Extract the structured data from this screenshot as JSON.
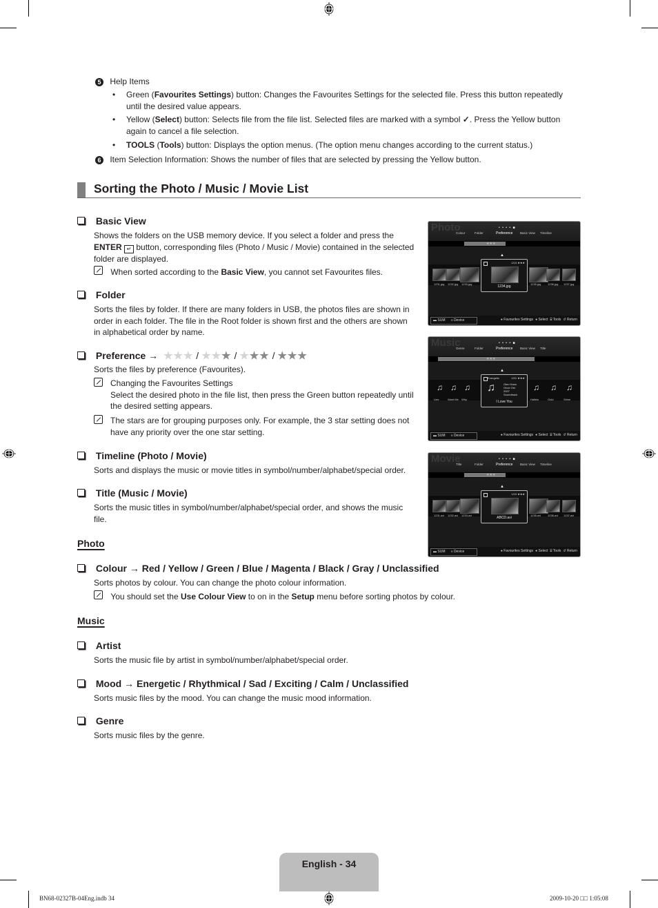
{
  "help_items": {
    "badge": "5",
    "title": "Help Items",
    "bullets": [
      {
        "pre": "Green (",
        "bold": "Favourites Settings",
        "post": ") button: Changes the Favourites Settings for the selected file. Press this button repeatedly",
        "cont": "until the desired value appears."
      },
      {
        "pre": "Yellow (",
        "bold": "Select",
        "post": ") button: Selects file from the file list. Selected files are marked with a symbol",
        "mark": "✓",
        "post2": ". Press the Yellow button",
        "cont": "again to cancel a file selection."
      },
      {
        "bold0": "TOOLS",
        "pre": " (",
        "bold": "Tools",
        "post": ") button: Displays the option menus. (The option menu changes according to the current status.)"
      }
    ]
  },
  "item_selection": {
    "badge": "6",
    "text": "Item Selection Information: Shows the number of files that are selected by pressing the Yellow button."
  },
  "section_title": "Sorting the Photo / Music / Movie List",
  "basic_view": {
    "title": "Basic View",
    "line1": "Shows the folders on the USB memory device. If you select a folder and press the",
    "enter": "ENTER",
    "line2": " button, corresponding files (Photo / Music / Movie) contained in the selected",
    "line3": "folder are displayed.",
    "note_pre": "When sorted according to the ",
    "note_bold": "Basic View",
    "note_post": ", you cannot set Favourites files."
  },
  "folder": {
    "title": "Folder",
    "lines": [
      "Sorts the files by folder. If there are many folders in USB, the photos files are shown in",
      "order in each folder. The file in the Root folder is shown first and the others are shown",
      "in alphabetical order by name."
    ]
  },
  "preference": {
    "title": "Preference →",
    "star_sets": [
      0,
      1,
      2,
      3
    ],
    "sep": "/",
    "desc": "Sorts the files by preference (Favourites).",
    "note1_title": "Changing the Favourites Settings",
    "note1_lines": [
      "Select the desired photo in the file list, then press the Green button repeatedly until",
      "the desired setting appears."
    ],
    "note2_lines": [
      "The stars are for grouping purposes only. For example, the 3 star setting does not",
      "have any priority over the one star setting."
    ]
  },
  "timeline": {
    "title": "Timeline (Photo / Movie)",
    "desc": "Sorts and displays the music or movie titles in symbol/number/alphabet/special order."
  },
  "title_sort": {
    "title": "Title (Music / Movie)",
    "lines": [
      "Sorts the music titles in symbol/number/alphabet/special order, and shows the music",
      "file."
    ]
  },
  "photo_heading": "Photo",
  "colour": {
    "title": "Colour → Red / Yellow / Green / Blue / Magenta / Black / Gray / Unclassified",
    "desc": "Sorts photos by colour. You can change the photo colour information.",
    "note_pre": "You should set the ",
    "note_b1": "Use Colour View",
    "note_mid": " to on in the ",
    "note_b2": "Setup",
    "note_post": " menu before sorting photos by colour."
  },
  "music_heading": "Music",
  "artist": {
    "title": "Artist",
    "desc": "Sorts the music file by artist in symbol/number/alphabet/special order."
  },
  "mood": {
    "title": "Mood → Energetic / Rhythmical / Sad / Exciting / Calm / Unclassified",
    "desc": "Sorts music files by the mood. You can change the music mood information."
  },
  "genre": {
    "title": "Genre",
    "desc": "Sorts music files by the genre."
  },
  "page_label": "English - 34",
  "footer": {
    "left": "BN68-02327B-04Eng.indb   34",
    "right": "2009-10-20   □□ 1:05:08"
  },
  "screens": {
    "photo": {
      "title": "Photo",
      "tabs": [
        "Colour",
        "Folder",
        "Preference",
        "Basic View",
        "Timeline"
      ],
      "active_tab": "Preference",
      "bar_label": "★★★",
      "selected_file": "1234.jpg",
      "counter": "1/15",
      "files": [
        "1231.jpg",
        "1232.jpg",
        "1233.jpg",
        "1235.jpg",
        "1236.jpg",
        "1237.jpg"
      ]
    },
    "music": {
      "title": "Music",
      "tabs": [
        "Genre",
        "Folder",
        "Preference",
        "Basic View",
        "Title"
      ],
      "active_tab": "Preference",
      "bar_label": "★★★",
      "selected_file": "I Love You",
      "mood": "Energetic",
      "counter": "2/21",
      "meta": [
        "Glen Hans",
        "Once Ost",
        "2007",
        "Soundtrack"
      ],
      "files": [
        "Lies",
        "Want Me",
        "Why",
        "Hallelu",
        "Gold",
        "Shine"
      ]
    },
    "movie": {
      "title": "Movie",
      "tabs": [
        "Title",
        "Folder",
        "Preference",
        "Basic View",
        "Timeline"
      ],
      "active_tab": "Preference",
      "bar_label": "★★★",
      "selected_file": "ABCD.avi",
      "counter": "1/15",
      "files": [
        "1231.avi",
        "1232.avi",
        "1233.avi",
        "1235.avi",
        "1236.avi",
        "1237.avi"
      ]
    },
    "footer": {
      "sum": "SUM",
      "device": "Device",
      "help": "Favourites Settings",
      "select": "Select",
      "tools": "Tools",
      "return": "Return"
    }
  }
}
